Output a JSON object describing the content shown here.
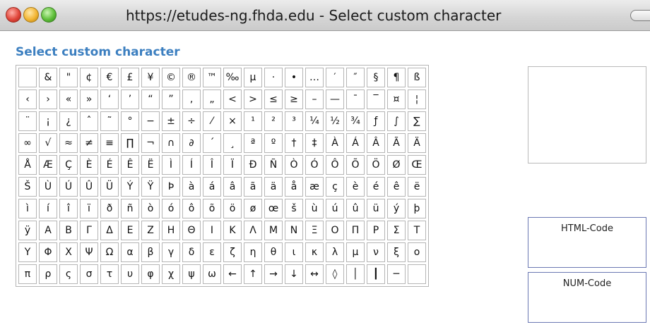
{
  "window": {
    "title": "https://etudes-ng.fhda.edu - Select custom character"
  },
  "page": {
    "heading": "Select custom character"
  },
  "grid": {
    "rows": [
      [
        "",
        "&",
        "\"",
        "¢",
        "€",
        "£",
        "¥",
        "©",
        "®",
        "™",
        "‰",
        "µ",
        "·",
        "•",
        "…",
        "′",
        "″",
        "§",
        "¶",
        "ß"
      ],
      [
        "‹",
        "›",
        "«",
        "»",
        "‘",
        "’",
        "“",
        "”",
        "‚",
        "„",
        "<",
        ">",
        "≤",
        "≥",
        "–",
        "—",
        "¯",
        "‾",
        "¤",
        "¦"
      ],
      [
        "¨",
        "¡",
        "¿",
        "ˆ",
        "˜",
        "°",
        "−",
        "±",
        "÷",
        "⁄",
        "×",
        "¹",
        "²",
        "³",
        "¼",
        "½",
        "¾",
        "ƒ",
        "∫",
        "∑"
      ],
      [
        "∞",
        "√",
        "≈",
        "≠",
        "≡",
        "∏",
        "¬",
        "∩",
        "∂",
        "´",
        "¸",
        "ª",
        "º",
        "†",
        "‡",
        "À",
        "Á",
        "Â",
        "Ã",
        "Ä"
      ],
      [
        "Å",
        "Æ",
        "Ç",
        "È",
        "É",
        "Ê",
        "Ë",
        "Ì",
        "Í",
        "Î",
        "Ï",
        "Ð",
        "Ñ",
        "Ò",
        "Ó",
        "Ô",
        "Õ",
        "Ö",
        "Ø",
        "Œ"
      ],
      [
        "Š",
        "Ù",
        "Ú",
        "Û",
        "Ü",
        "Ý",
        "Ÿ",
        "Þ",
        "à",
        "á",
        "â",
        "ã",
        "ä",
        "å",
        "æ",
        "ç",
        "è",
        "é",
        "ê",
        "ë"
      ],
      [
        "ì",
        "í",
        "î",
        "ï",
        "ð",
        "ñ",
        "ò",
        "ó",
        "ô",
        "õ",
        "ö",
        "ø",
        "œ",
        "š",
        "ù",
        "ú",
        "û",
        "ü",
        "ý",
        "þ"
      ],
      [
        "ÿ",
        "Α",
        "Β",
        "Γ",
        "Δ",
        "Ε",
        "Ζ",
        "Η",
        "Θ",
        "Ι",
        "Κ",
        "Λ",
        "Μ",
        "Ν",
        "Ξ",
        "Ο",
        "Π",
        "Ρ",
        "Σ",
        "Τ"
      ],
      [
        "Υ",
        "Φ",
        "Χ",
        "Ψ",
        "Ω",
        "α",
        "β",
        "γ",
        "δ",
        "ε",
        "ζ",
        "η",
        "θ",
        "ι",
        "κ",
        "λ",
        "μ",
        "ν",
        "ξ",
        "ο"
      ],
      [
        "π",
        "ρ",
        "ς",
        "σ",
        "τ",
        "υ",
        "φ",
        "χ",
        "ψ",
        "ω",
        "←",
        "↑",
        "→",
        "↓",
        "↔",
        "◊",
        "│",
        "┃",
        "─",
        ""
      ]
    ]
  },
  "preview": {
    "html_code_label": "HTML-Code",
    "num_code_label": "NUM-Code"
  }
}
